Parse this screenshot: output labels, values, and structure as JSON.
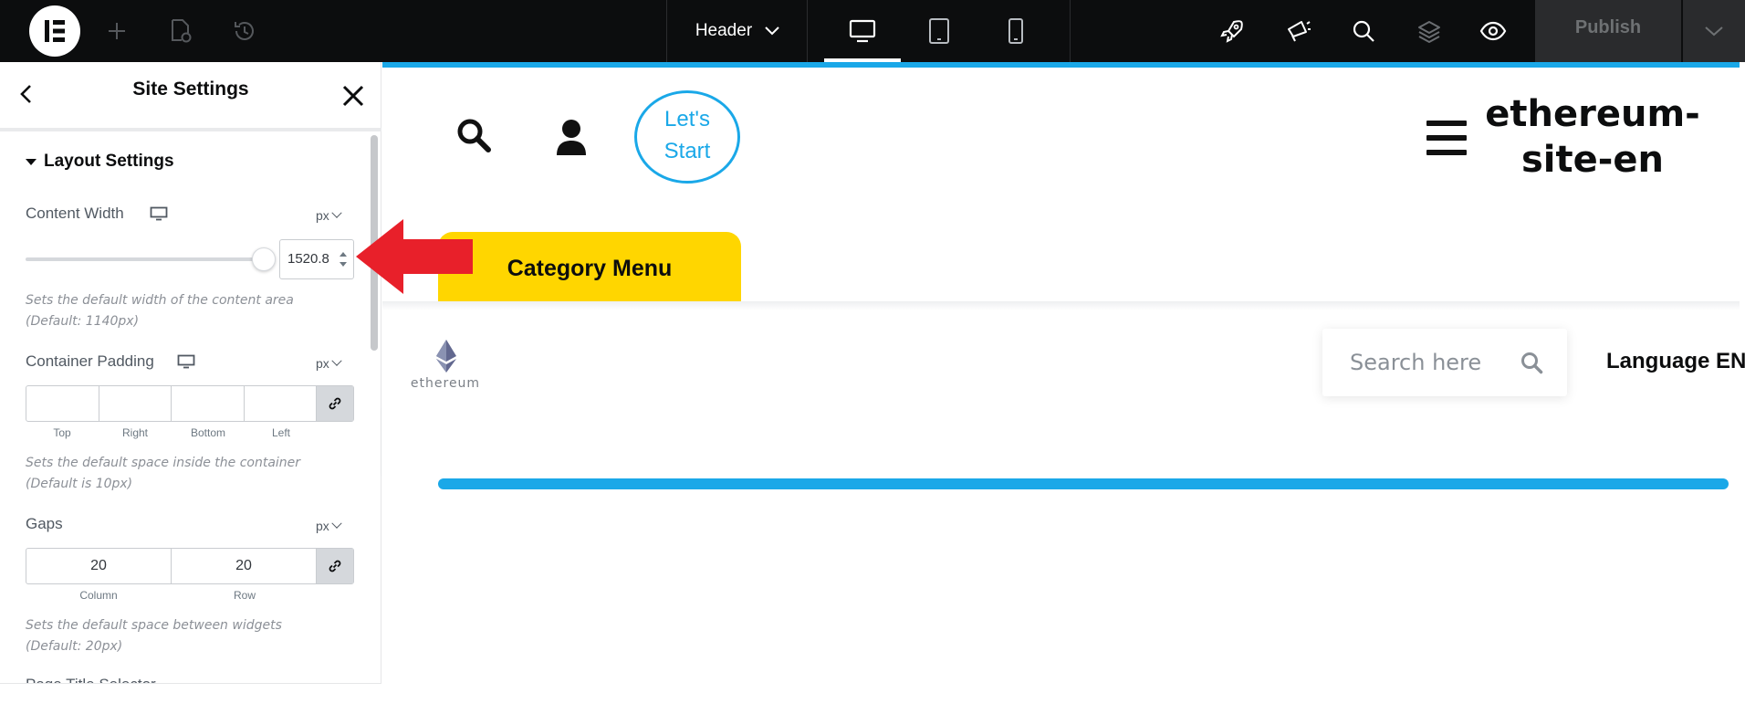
{
  "topbar": {
    "header_dropdown_label": "Header",
    "publish_label": "Publish",
    "icons": [
      "elementor-logo-icon",
      "plus-icon",
      "page-settings-icon",
      "history-icon",
      "desktop-icon",
      "tablet-icon",
      "mobile-icon",
      "rocket-icon",
      "megaphone-icon",
      "search-icon",
      "layers-icon",
      "eye-icon",
      "chevron-down-icon"
    ]
  },
  "panel": {
    "title": "Site Settings",
    "section_title": "Layout Settings",
    "content_width": {
      "label": "Content Width",
      "unit": "px",
      "value": "1520.8",
      "description": "Sets the default width of the content area (Default: 1140px)"
    },
    "container_padding": {
      "label": "Container Padding",
      "unit": "px",
      "top": "",
      "right": "",
      "bottom": "",
      "left": "",
      "labels": [
        "Top",
        "Right",
        "Bottom",
        "Left"
      ],
      "description": "Sets the default space inside the container (Default is 10px)"
    },
    "gaps": {
      "label": "Gaps",
      "unit": "px",
      "column": "20",
      "row": "20",
      "labels": [
        "Column",
        "Row"
      ],
      "description": "Sets the default space between widgets (Default: 20px)"
    },
    "next_label_partial": "Page Title Selector"
  },
  "preview": {
    "lets_start_line1": "Let's",
    "lets_start_line2": "Start",
    "site_title_line1": "ethereum-",
    "site_title_line2": "site-en",
    "category_menu": "Category Menu",
    "logo_word": "ethereum",
    "search_placeholder": "Search here",
    "language": "Language EN",
    "accent_color": "#1aa8e8",
    "category_color": "#ffd600"
  },
  "annotation": {
    "arrow_color": "#e8202a"
  }
}
